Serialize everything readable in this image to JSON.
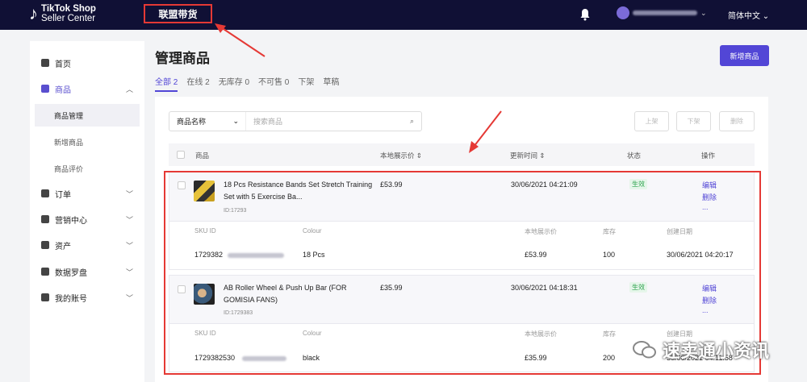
{
  "brand": {
    "line1": "TikTok Shop",
    "line2": "Seller Center"
  },
  "top_nav": {
    "affiliate": "联盟带货"
  },
  "header": {
    "language": "简体中文 ⌄"
  },
  "sidebar": {
    "items": [
      {
        "label": "首页",
        "icon": "home-icon"
      },
      {
        "label": "商品",
        "icon": "product-icon",
        "expanded": true
      },
      {
        "label": "订单",
        "icon": "order-icon"
      },
      {
        "label": "营销中心",
        "icon": "megaphone-icon"
      },
      {
        "label": "资产",
        "icon": "wallet-icon"
      },
      {
        "label": "数据罗盘",
        "icon": "chart-icon"
      },
      {
        "label": "我的账号",
        "icon": "user-icon"
      }
    ],
    "sub_items": [
      "商品管理",
      "新增商品",
      "商品评价"
    ]
  },
  "page": {
    "title": "管理商品",
    "add_button": "新增商品"
  },
  "tabs": [
    {
      "label": "全部 2",
      "active": true
    },
    {
      "label": "在线 2"
    },
    {
      "label": "无库存 0"
    },
    {
      "label": "不可售 0"
    },
    {
      "label": "下架"
    },
    {
      "label": "草稿"
    }
  ],
  "filter": {
    "select": "商品名称",
    "placeholder": "搜索商品"
  },
  "actions": {
    "list": "上架",
    "delist": "下架",
    "delete": "删除"
  },
  "columns": {
    "product": "商品",
    "price": "本地展示价 ⇕",
    "updated": "更新时间 ⇕",
    "status": "状态",
    "ops": "操作"
  },
  "sku_columns": {
    "sku_id": "SKU ID",
    "colour": "Colour",
    "price": "本地展示价",
    "stock": "库存",
    "created": "创建日期"
  },
  "products": [
    {
      "name": "18 Pcs Resistance Bands Set Stretch Training Set with 5 Exercise Ba...",
      "id": "ID:17293",
      "price": "£53.99",
      "updated": "30/06/2021 04:21:09",
      "status": "生效",
      "edit": "编辑",
      "delete": "删除",
      "more": "...",
      "sku": {
        "id": "1729382",
        "colour": "18 Pcs",
        "price": "£53.99",
        "stock": "100",
        "created": "30/06/2021 04:20:17"
      }
    },
    {
      "name": "AB Roller Wheel & Push Up Bar (FOR GOMISIA FANS)",
      "id": "ID:1729383",
      "price": "£35.99",
      "updated": "30/06/2021 04:18:31",
      "status": "生效",
      "edit": "编辑",
      "delete": "删除",
      "more": "...",
      "sku": {
        "id": "1729382530",
        "colour": "black",
        "price": "£35.99",
        "stock": "200",
        "created": "30/06/2021 04:11:58"
      }
    }
  ],
  "watermark": "速卖通小资讯",
  "colors": {
    "topbar": "#101035",
    "accent": "#5246d6",
    "highlight": "#e53935",
    "status": "#2ea44f"
  }
}
